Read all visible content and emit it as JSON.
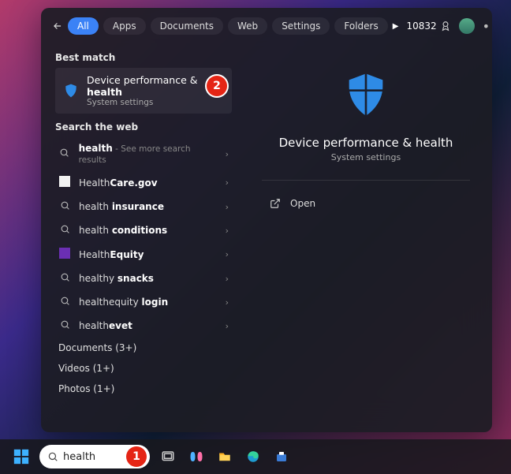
{
  "header": {
    "tabs": [
      "All",
      "Apps",
      "Documents",
      "Web",
      "Settings",
      "Folders"
    ],
    "points": "10832"
  },
  "left": {
    "best_match_label": "Best match",
    "best_match": {
      "title_pre": "Device performance & ",
      "title_bold": "health",
      "subtitle": "System settings"
    },
    "search_web_label": "Search the web",
    "web_items": [
      {
        "icon": "search",
        "pre": "",
        "bold": "health",
        "suf": "",
        "hint": " - See more search results"
      },
      {
        "icon": "white",
        "pre": "Health",
        "bold": "Care.gov",
        "suf": "",
        "hint": ""
      },
      {
        "icon": "search",
        "pre": "health ",
        "bold": "insurance",
        "suf": "",
        "hint": ""
      },
      {
        "icon": "search",
        "pre": "health ",
        "bold": "conditions",
        "suf": "",
        "hint": ""
      },
      {
        "icon": "purple",
        "pre": "Health",
        "bold": "Equity",
        "suf": "",
        "hint": ""
      },
      {
        "icon": "search",
        "pre": "healthy ",
        "bold": "snacks",
        "suf": "",
        "hint": ""
      },
      {
        "icon": "search",
        "pre": "healthequity ",
        "bold": "login",
        "suf": "",
        "hint": ""
      },
      {
        "icon": "search",
        "pre": "health",
        "bold": "evet",
        "suf": "",
        "hint": ""
      }
    ],
    "docs_label": "Documents (3+)",
    "videos_label": "Videos (1+)",
    "photos_label": "Photos (1+)"
  },
  "right": {
    "title": "Device performance & health",
    "subtitle": "System settings",
    "open_label": "Open"
  },
  "taskbar": {
    "search_value": "health"
  },
  "markers": {
    "one": "1",
    "two": "2"
  },
  "colors": {
    "accent": "#3b82f6",
    "shield": "#2e8be6",
    "marker": "#e52515"
  }
}
